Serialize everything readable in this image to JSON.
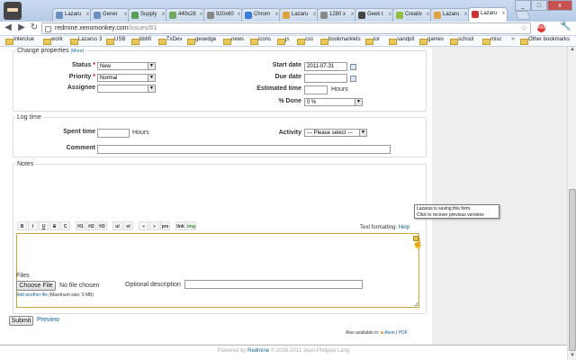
{
  "browser": {
    "tabs": [
      "Lazaru",
      "Gener",
      "Supply",
      "440x28",
      "920x60",
      "Chrom",
      "Lazaru",
      "1280 x",
      "Geek t",
      "Creativ",
      "Lazaru"
    ],
    "url_host": "redmine.xenomonkey.com",
    "url_path": "/issues/81",
    "ext_badge": "ABP",
    "bookmarks": [
      "Interclue",
      "work",
      "Lazarus 3",
      "USB",
      "bbhfi",
      "TxDev",
      "geoedge",
      "news",
      "icons",
      "js",
      "css",
      "bookmarklets",
      "tor",
      "sandpit",
      "games",
      "school",
      "misc"
    ],
    "bookmarks_more": "»",
    "other_bookmarks": "Other bookmarks"
  },
  "change_properties": {
    "legend": "Change properties",
    "more": "(More)",
    "status_label": "Status",
    "status_value": "New",
    "priority_label": "Priority",
    "priority_value": "Normal",
    "assignee_label": "Assignee",
    "assignee_value": "",
    "start_date_label": "Start date",
    "start_date_value": "2011-07-31",
    "due_date_label": "Due date",
    "due_date_value": "",
    "estimated_label": "Estimated time",
    "estimated_value": "",
    "estimated_unit": "Hours",
    "done_label": "% Done",
    "done_value": "0 %",
    "required_mark": "*"
  },
  "log_time": {
    "legend": "Log time",
    "spent_label": "Spent time",
    "spent_value": "",
    "spent_unit": "Hours",
    "activity_label": "Activity",
    "activity_value": "--- Please select ---",
    "comment_label": "Comment",
    "comment_value": ""
  },
  "notes": {
    "legend": "Notes",
    "toolbar": [
      "B",
      "I",
      "U",
      "S",
      "C",
      "H1",
      "H2",
      "H3",
      "ul",
      "ol",
      "«",
      "»",
      "pre",
      "link",
      "img"
    ],
    "text_formatting": "Text formatting:",
    "help": "Help",
    "tooltip_line1": "Lazarus is saving this form.",
    "tooltip_line2": "Click to recover previous versions"
  },
  "files": {
    "label": "Files",
    "choose": "Choose File",
    "no_file": "No file chosen",
    "optional_desc": "Optional description",
    "add_another": "Add another file",
    "max_size": "(Maximum size: 5 MB)"
  },
  "actions": {
    "submit": "Submit",
    "preview": "Preview",
    "available_in": "Also available in:",
    "atom": "Atom",
    "sep": "|",
    "pdf": "PDF"
  },
  "footer": {
    "powered": "Powered by",
    "redmine": "Redmine",
    "copyright": "© 2006-2011 Jean-Philippe Lang"
  }
}
